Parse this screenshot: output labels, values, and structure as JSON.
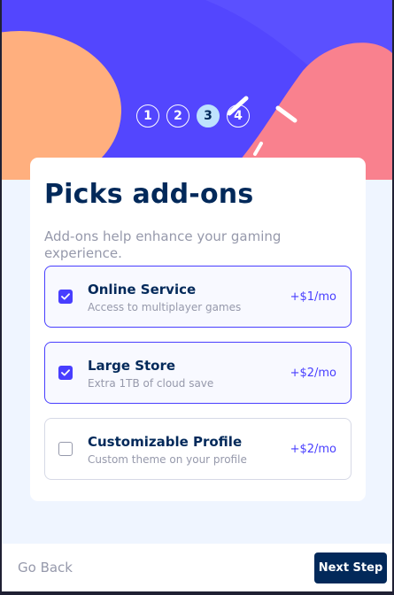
{
  "steps": [
    "1",
    "2",
    "3",
    "4"
  ],
  "active_step": "3",
  "form": {
    "title": "Picks add-ons",
    "subtitle": "Add-ons help enhance your gaming experience."
  },
  "addons": [
    {
      "name": "Online Service",
      "description": "Access to multiplayer games",
      "price": "+$1/mo",
      "checked": true
    },
    {
      "name": "Large Store",
      "description": "Extra 1TB of cloud save",
      "price": "+$2/mo",
      "checked": true
    },
    {
      "name": "Customizable Profile",
      "description": "Custom theme on your profile",
      "price": "+$2/mo",
      "checked": false
    }
  ],
  "footer": {
    "back_label": "Go Back",
    "next_label": "Next Step"
  },
  "colors": {
    "marine_blue": "#02295a",
    "purplish_blue": "#483eff",
    "light_blue": "#bee2fd",
    "cool_gray": "#9699ab",
    "light_gray": "#d6d9e6",
    "magnolia": "#eff5ff",
    "hero_purple": "#5c4cff",
    "hero_orange": "#ffaf7e",
    "hero_pink": "#f9818e"
  }
}
